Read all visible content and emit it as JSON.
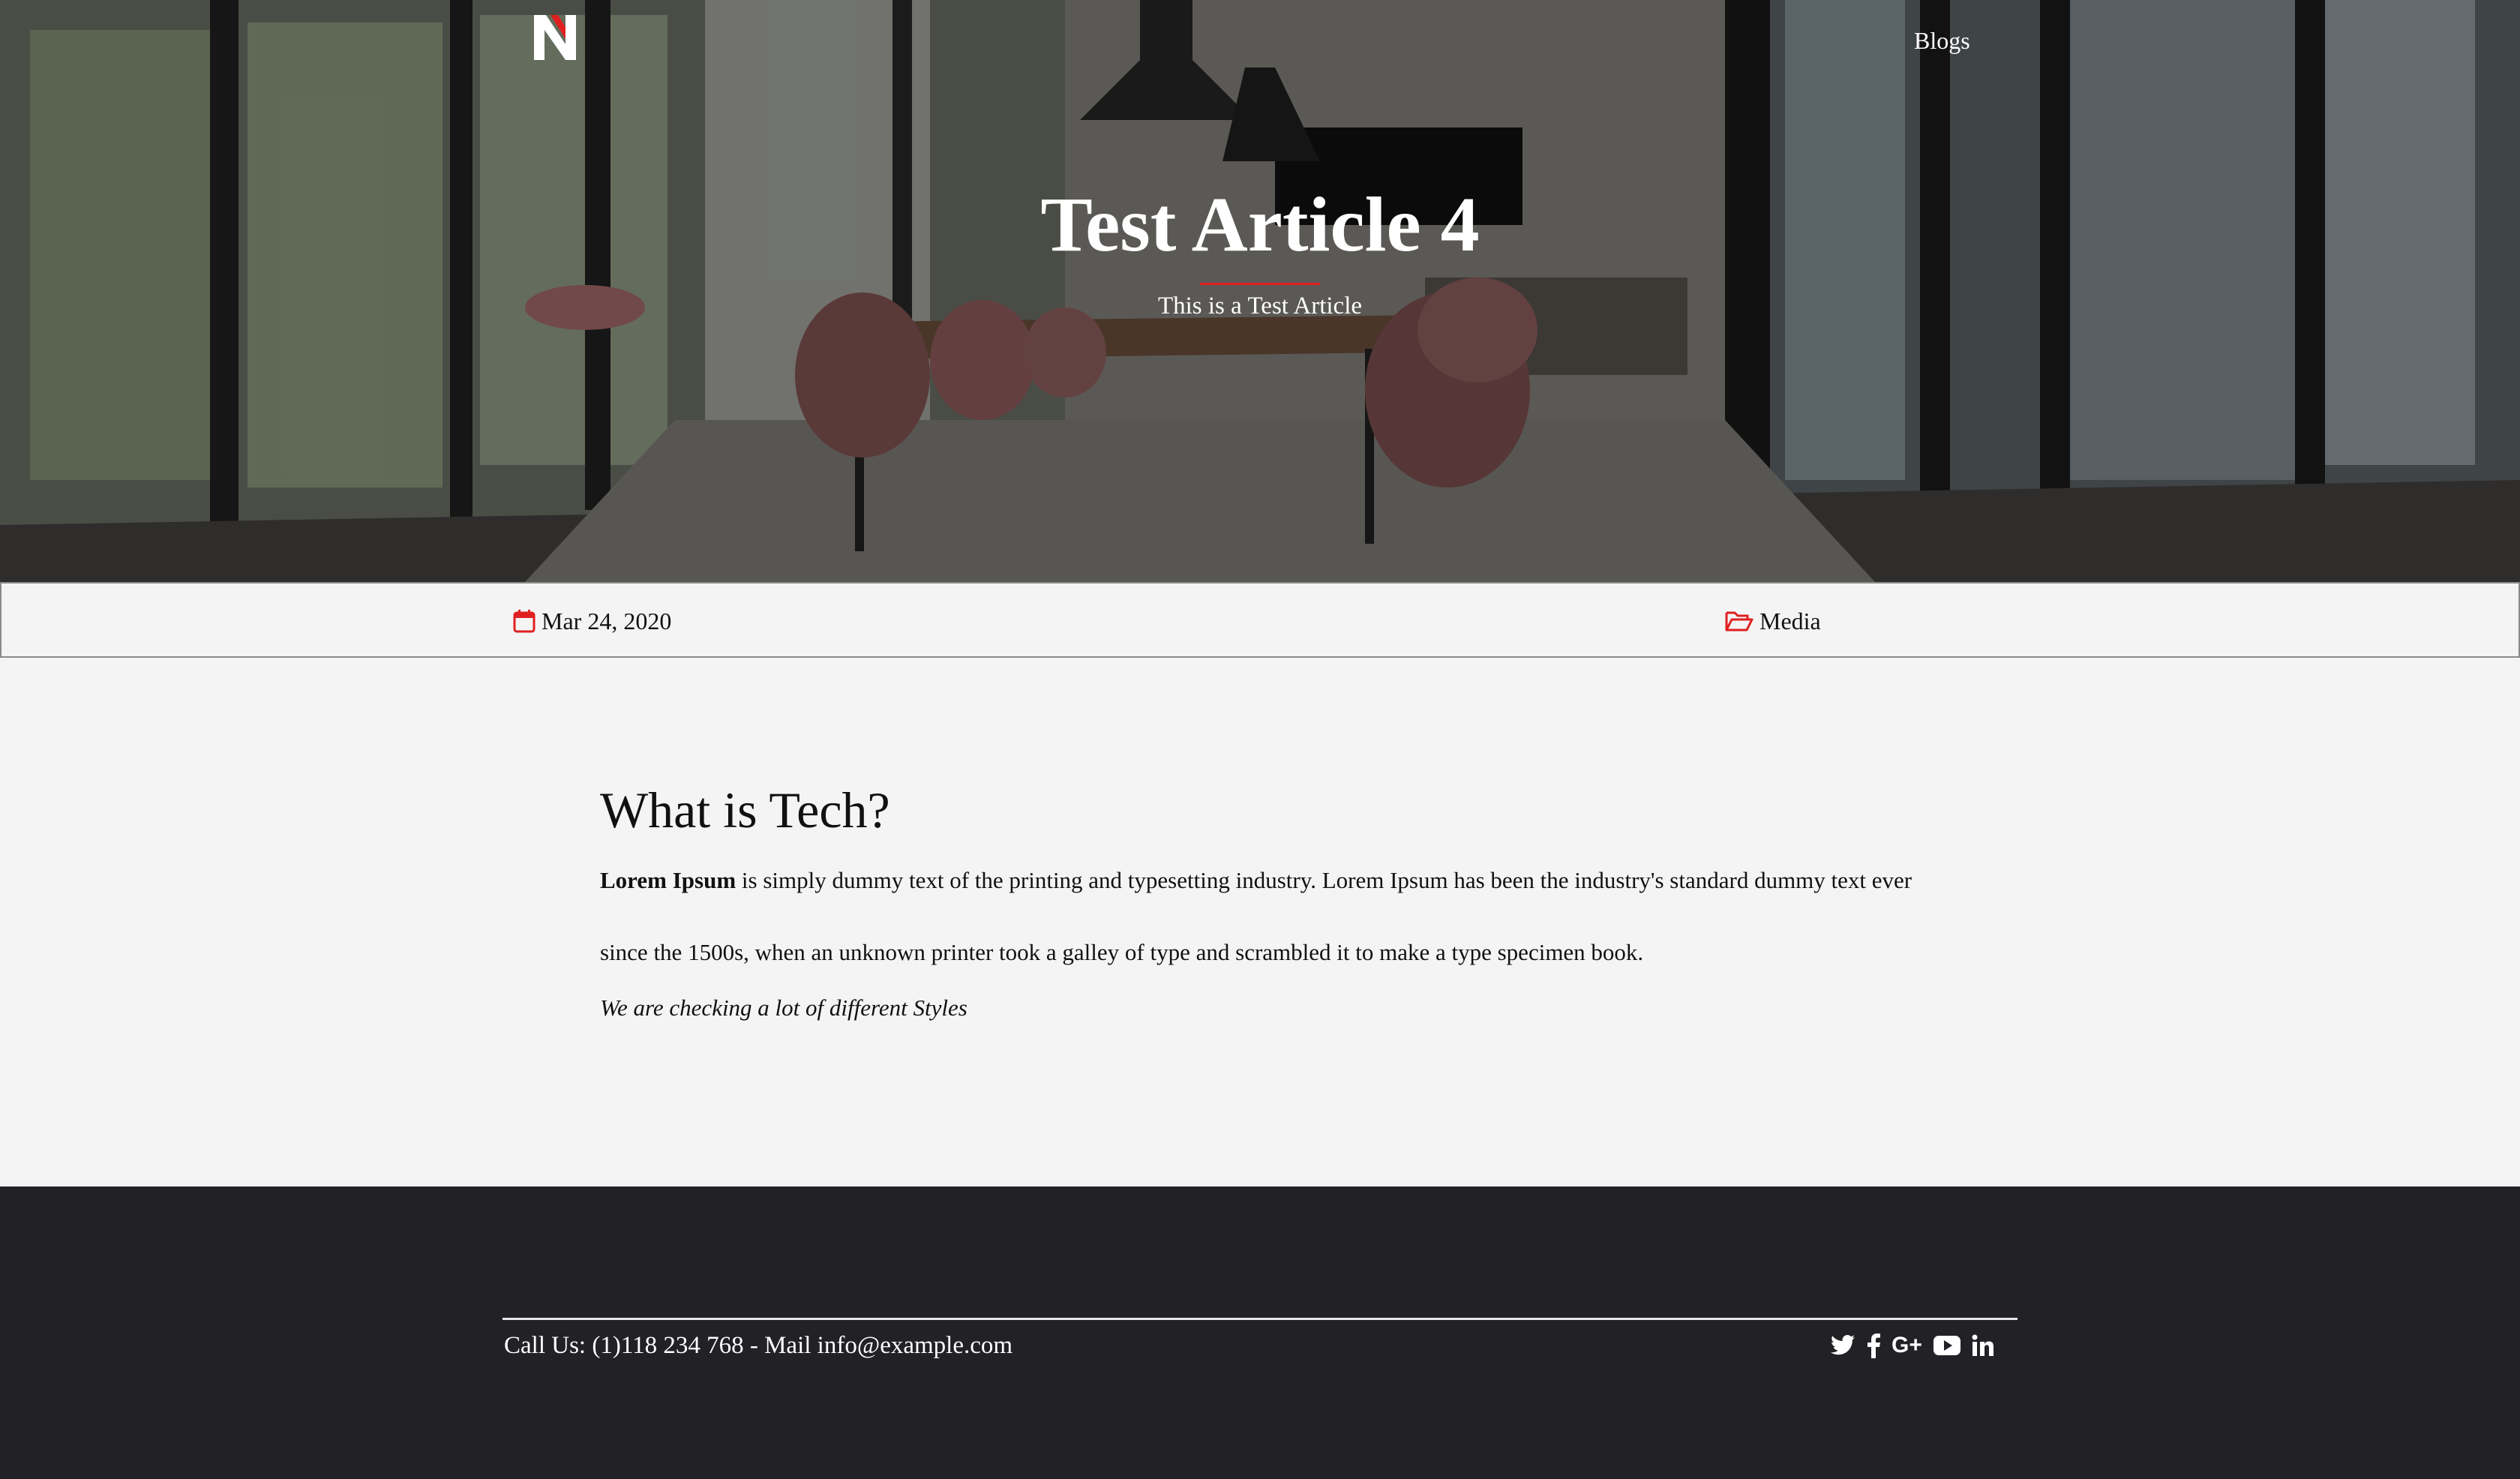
{
  "header": {
    "nav": {
      "blogs_label": "Blogs"
    }
  },
  "hero": {
    "title": "Test Article 4",
    "subtitle": "This is a Test Article",
    "accent_color": "#e02020"
  },
  "meta": {
    "date": "Mar 24, 2020",
    "category": "Media",
    "icon_color": "#e02020",
    "date_icon": "calendar-icon",
    "category_icon": "folder-open-icon"
  },
  "article": {
    "heading": "What is Tech?",
    "lead_bold": "Lorem Ipsum",
    "body_text": " is simply dummy text of the printing and typesetting industry. Lorem Ipsum has been the industry's standard dummy text ever since the 1500s, when an unknown printer took a galley of type and scrambled it to make a type specimen book.",
    "italic_text": "We are checking a lot of different Styles"
  },
  "footer": {
    "contact": "Call Us: (1)118 234 768 - Mail info@example.com",
    "gplus_label": "G+",
    "social_icons": [
      "twitter-icon",
      "facebook-icon",
      "google-plus-icon",
      "youtube-icon",
      "linkedin-icon"
    ],
    "background_color": "#222126"
  }
}
